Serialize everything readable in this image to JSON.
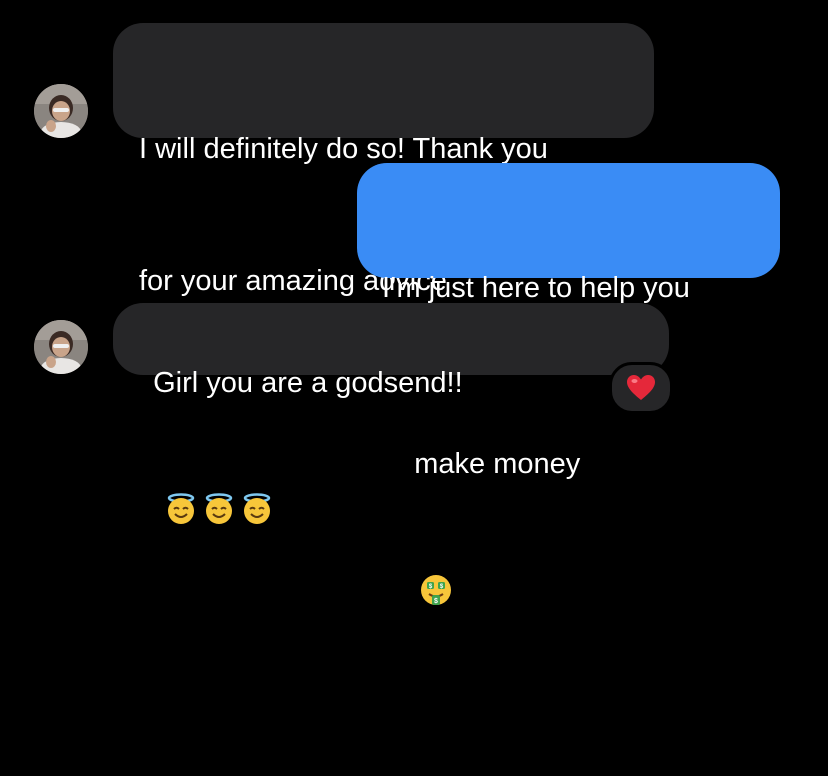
{
  "messages": [
    {
      "direction": "incoming",
      "line1": "I will definitely do so! Thank you",
      "line2": "for your amazing advice"
    },
    {
      "direction": "outgoing",
      "line1": "I’m just here to help you",
      "line2": "make money",
      "emoji": "money-mouth-face"
    },
    {
      "direction": "incoming",
      "text": "Girl you are a godsend!!",
      "emojis": [
        "smiling-face-with-halo",
        "smiling-face-with-halo",
        "smiling-face-with-halo"
      ],
      "reaction": "red-heart"
    }
  ],
  "colors": {
    "background": "#000000",
    "incoming_bubble": "#262628",
    "outgoing_bubble": "#3a8cf5",
    "text": "#ffffff"
  }
}
